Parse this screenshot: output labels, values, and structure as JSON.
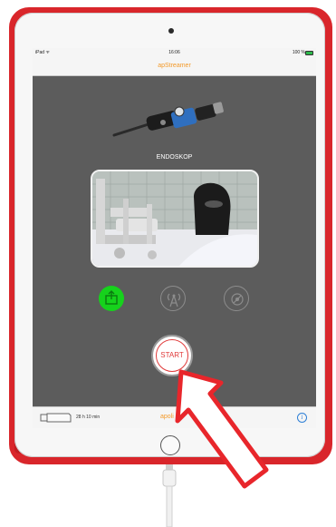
{
  "statusbar": {
    "carrier": "iPad ᯤ",
    "time": "16:06",
    "battery": "100 %"
  },
  "navbar": {
    "title": "apStreamer"
  },
  "device": {
    "name": "ENDOSKOP"
  },
  "indicators": [
    {
      "name": "upload-icon",
      "state": "active"
    },
    {
      "name": "broadcast-icon",
      "state": "inactive"
    },
    {
      "name": "record-icon",
      "state": "inactive"
    }
  ],
  "start_button": {
    "label": "START"
  },
  "bottombar": {
    "storage_time": "28 h 10 min",
    "brand": "apoli",
    "info": "i"
  },
  "colors": {
    "accent": "#f39a2a",
    "case": "#d9262b",
    "screen_bg": "#5c5c5c",
    "active_green": "#16d21c",
    "start_red": "#e03a3a",
    "arrow_red": "#e8262b"
  }
}
